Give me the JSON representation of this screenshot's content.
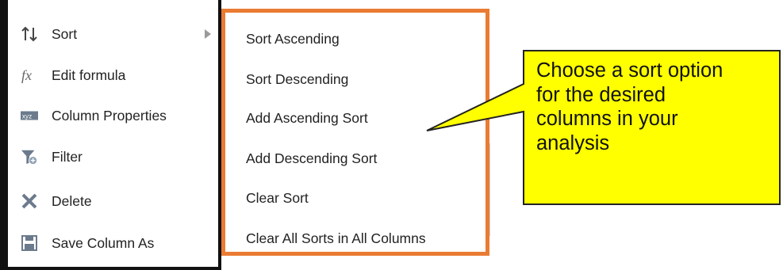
{
  "context_menu": {
    "items": [
      {
        "label": "Sort",
        "icon": "sort-icon",
        "has_submenu": true
      },
      {
        "label": "Edit formula",
        "icon": "fx-icon"
      },
      {
        "label": "Column Properties",
        "icon": "xyz-icon"
      },
      {
        "label": "Filter",
        "icon": "filter-icon"
      },
      {
        "label": "Delete",
        "icon": "close-icon"
      },
      {
        "label": "Save Column As",
        "icon": "save-icon"
      }
    ]
  },
  "submenu": {
    "items": [
      {
        "label": "Sort Ascending"
      },
      {
        "label": "Sort Descending"
      },
      {
        "label": "Add Ascending Sort"
      },
      {
        "label": "Add Descending Sort"
      },
      {
        "label": "Clear Sort"
      },
      {
        "label": "Clear All Sorts in All Columns"
      }
    ]
  },
  "callout": {
    "line1": "Choose a sort option",
    "line2": "for the desired",
    "line3": "columns in your",
    "line4": "analysis"
  },
  "colors": {
    "submenu_border": "#ea7b33",
    "callout_fill": "#ffff00",
    "callout_border": "#222222",
    "menu_border": "#111111"
  }
}
